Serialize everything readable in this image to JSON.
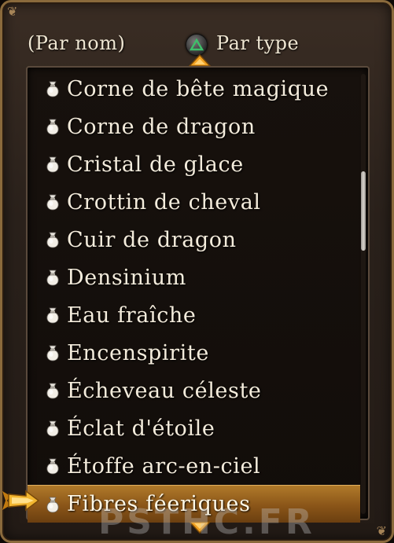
{
  "sort": {
    "by_name_label": "(Par nom)",
    "by_type_label": "Par type"
  },
  "list": {
    "items": [
      {
        "label": "Corne de bête magique"
      },
      {
        "label": "Corne de dragon"
      },
      {
        "label": "Cristal de glace"
      },
      {
        "label": "Crottin de cheval"
      },
      {
        "label": "Cuir de dragon"
      },
      {
        "label": "Densinium"
      },
      {
        "label": "Eau fraîche"
      },
      {
        "label": "Encenspirite"
      },
      {
        "label": "Écheveau céleste"
      },
      {
        "label": "Éclat d'étoile"
      },
      {
        "label": "Étoffe arc-en-ciel"
      },
      {
        "label": "Fibres féeriques"
      }
    ],
    "selected_index": 11,
    "scroll_position": 0.27,
    "scroll_visible_fraction": 0.18
  },
  "watermark": "PSTHC.FR",
  "colors": {
    "frame": "#8a6a3c",
    "selected_highlight": "#a06a20",
    "arrow": "#f0a020",
    "triangle": "#3fbf6a"
  }
}
